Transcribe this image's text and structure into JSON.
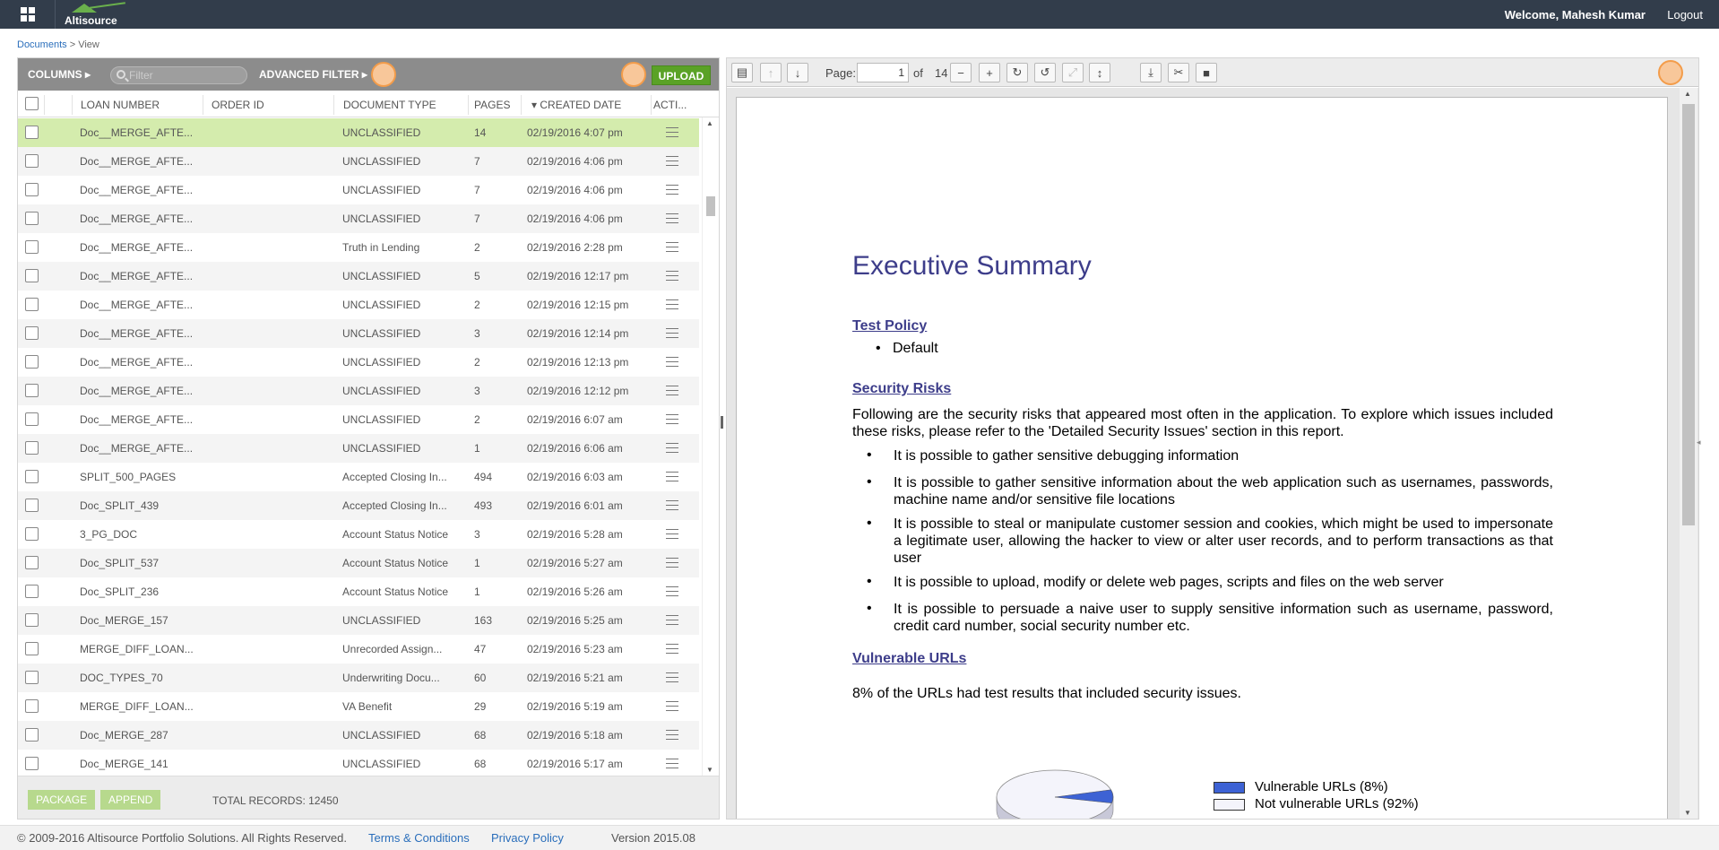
{
  "header": {
    "brand": "Altisource",
    "welcome": "Welcome,  Mahesh Kumar",
    "logout": "Logout"
  },
  "breadcrumb": {
    "root": "Documents",
    "sep": " > ",
    "current": "View"
  },
  "toolbar": {
    "columns": "COLUMNS ▸",
    "filter_placeholder": "Filter",
    "advanced_filter": "ADVANCED FILTER ▸",
    "upload": "UPLOAD"
  },
  "table": {
    "headers": {
      "loan": "LOAN NUMBER",
      "order": "ORDER ID",
      "doctype": "DOCUMENT TYPE",
      "pages": "PAGES",
      "created": "CREATED DATE",
      "actions": "ACTI..."
    },
    "sort_indicator": "▾",
    "rows": [
      {
        "loan": "Doc__MERGE_AFTE...",
        "order": "",
        "type": "UNCLASSIFIED",
        "pages": "14",
        "date": "02/19/2016 4:07 pm"
      },
      {
        "loan": "Doc__MERGE_AFTE...",
        "order": "",
        "type": "UNCLASSIFIED",
        "pages": "7",
        "date": "02/19/2016 4:06 pm"
      },
      {
        "loan": "Doc__MERGE_AFTE...",
        "order": "",
        "type": "UNCLASSIFIED",
        "pages": "7",
        "date": "02/19/2016 4:06 pm"
      },
      {
        "loan": "Doc__MERGE_AFTE...",
        "order": "",
        "type": "UNCLASSIFIED",
        "pages": "7",
        "date": "02/19/2016 4:06 pm"
      },
      {
        "loan": "Doc__MERGE_AFTE...",
        "order": "",
        "type": "Truth in Lending",
        "pages": "2",
        "date": "02/19/2016 2:28 pm"
      },
      {
        "loan": "Doc__MERGE_AFTE...",
        "order": "",
        "type": "UNCLASSIFIED",
        "pages": "5",
        "date": "02/19/2016 12:17 pm"
      },
      {
        "loan": "Doc__MERGE_AFTE...",
        "order": "",
        "type": "UNCLASSIFIED",
        "pages": "2",
        "date": "02/19/2016 12:15 pm"
      },
      {
        "loan": "Doc__MERGE_AFTE...",
        "order": "",
        "type": "UNCLASSIFIED",
        "pages": "3",
        "date": "02/19/2016 12:14 pm"
      },
      {
        "loan": "Doc__MERGE_AFTE...",
        "order": "",
        "type": "UNCLASSIFIED",
        "pages": "2",
        "date": "02/19/2016 12:13 pm"
      },
      {
        "loan": "Doc__MERGE_AFTE...",
        "order": "",
        "type": "UNCLASSIFIED",
        "pages": "3",
        "date": "02/19/2016 12:12 pm"
      },
      {
        "loan": "Doc__MERGE_AFTE...",
        "order": "",
        "type": "UNCLASSIFIED",
        "pages": "2",
        "date": "02/19/2016 6:07 am"
      },
      {
        "loan": "Doc__MERGE_AFTE...",
        "order": "",
        "type": "UNCLASSIFIED",
        "pages": "1",
        "date": "02/19/2016 6:06 am"
      },
      {
        "loan": "SPLIT_500_PAGES",
        "order": "",
        "type": "Accepted Closing In...",
        "pages": "494",
        "date": "02/19/2016 6:03 am"
      },
      {
        "loan": "Doc_SPLIT_439",
        "order": "",
        "type": "Accepted Closing In...",
        "pages": "493",
        "date": "02/19/2016 6:01 am"
      },
      {
        "loan": "3_PG_DOC",
        "order": "",
        "type": "Account Status Notice",
        "pages": "3",
        "date": "02/19/2016 5:28 am"
      },
      {
        "loan": "Doc_SPLIT_537",
        "order": "",
        "type": "Account Status Notice",
        "pages": "1",
        "date": "02/19/2016 5:27 am"
      },
      {
        "loan": "Doc_SPLIT_236",
        "order": "",
        "type": "Account Status Notice",
        "pages": "1",
        "date": "02/19/2016 5:26 am"
      },
      {
        "loan": "Doc_MERGE_157",
        "order": "",
        "type": "UNCLASSIFIED",
        "pages": "163",
        "date": "02/19/2016 5:25 am"
      },
      {
        "loan": "MERGE_DIFF_LOAN...",
        "order": "",
        "type": "Unrecorded Assign...",
        "pages": "47",
        "date": "02/19/2016 5:23 am"
      },
      {
        "loan": "DOC_TYPES_70",
        "order": "",
        "type": "Underwriting Docu...",
        "pages": "60",
        "date": "02/19/2016 5:21 am"
      },
      {
        "loan": "MERGE_DIFF_LOAN...",
        "order": "",
        "type": "VA Benefit",
        "pages": "29",
        "date": "02/19/2016 5:19 am"
      },
      {
        "loan": "Doc_MERGE_287",
        "order": "",
        "type": "UNCLASSIFIED",
        "pages": "68",
        "date": "02/19/2016 5:18 am"
      },
      {
        "loan": "Doc_MERGE_141",
        "order": "",
        "type": "UNCLASSIFIED",
        "pages": "68",
        "date": "02/19/2016 5:17 am"
      }
    ]
  },
  "list_footer": {
    "package": "PACKAGE",
    "append": "APPEND",
    "total": "TOTAL RECORDS: 12450"
  },
  "viewer": {
    "page_label": "Page:",
    "page_value": "1",
    "of_label": "of",
    "total_pages": "14",
    "document": {
      "title": "Executive Summary",
      "sec1": "Test Policy",
      "sec1_item": "Default",
      "sec2": "Security Risks",
      "sec2_intro": "Following are the security risks that appeared most often in the application.  To explore which issues included these risks, please refer to the 'Detailed Security Issues' section in this report.",
      "risks": [
        "It is possible to gather sensitive debugging information",
        "It is possible to gather sensitive information about the web application such as usernames, passwords, machine name and/or sensitive file locations",
        "It is possible to steal or manipulate customer session and cookies, which might be used to impersonate a legitimate user, allowing the hacker to view or alter user records, and to perform transactions as that user",
        "It is possible to upload, modify or delete web pages, scripts and files on the web server",
        "It is possible to persuade a naive user to supply sensitive information such as username, password, credit card number, social security number etc."
      ],
      "sec3": "Vulnerable URLs",
      "sec3_text": "8% of the URLs had test results that included security issues.",
      "legend_vuln": "Vulnerable URLs (8%)",
      "legend_notvuln": "Not vulnerable URLs (92%)",
      "pie_vulnerable_fraction": 0.08,
      "colors": {
        "vulnerable": "#3d62d4",
        "not_vulnerable": "#f4f4fb"
      }
    }
  },
  "footer": {
    "copyright": "© 2009-2016 Altisource Portfolio Solutions. All Rights Reserved.",
    "terms": "Terms & Conditions",
    "privacy": "Privacy Policy",
    "version": "Version 2015.08"
  },
  "colors": {
    "topbar": "#323d4b",
    "toolbar": "#8c8c8c",
    "selected_row": "#d4ecad",
    "upload": "#5aa226",
    "link": "#2a6ebb",
    "doc_heading": "#3d3d8a"
  }
}
